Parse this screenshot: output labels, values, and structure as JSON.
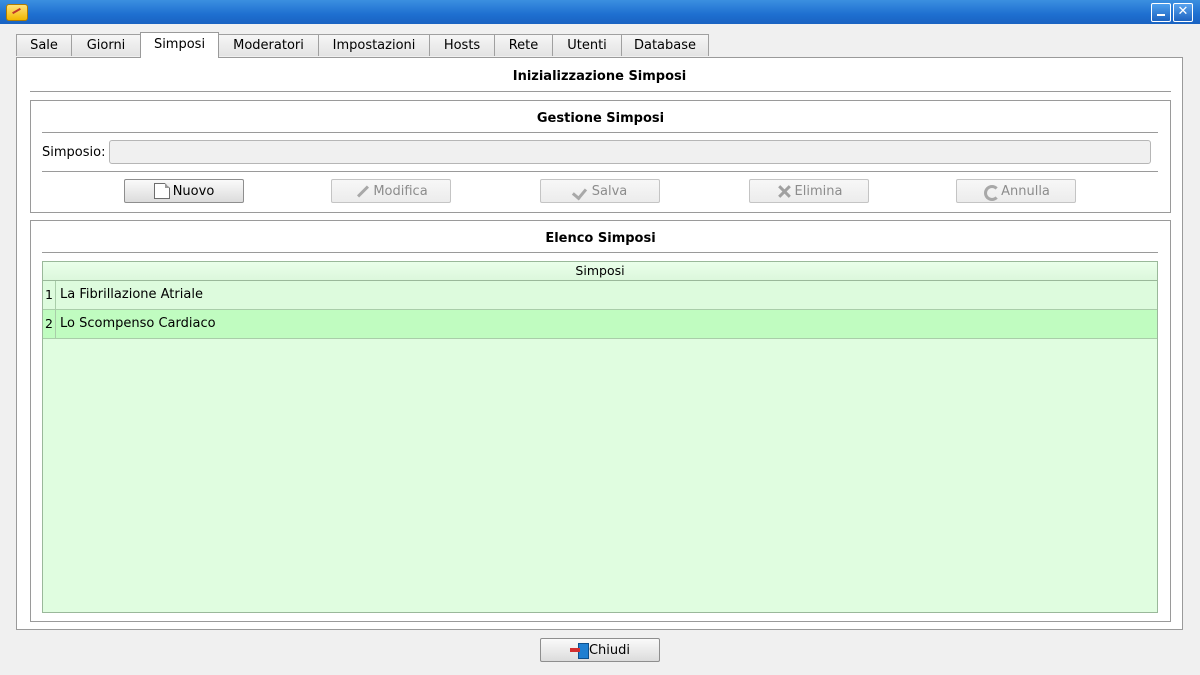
{
  "window": {
    "icon": "app-icon",
    "controls": {
      "minimize_icon": "minimize-icon",
      "close_icon": "close-icon",
      "close_glyph": "✕"
    }
  },
  "tabs": [
    {
      "label": "Sale",
      "active": false
    },
    {
      "label": "Giorni",
      "active": false
    },
    {
      "label": "Simposi",
      "active": true
    },
    {
      "label": "Moderatori",
      "active": false
    },
    {
      "label": "Impostazioni",
      "active": false
    },
    {
      "label": "Hosts",
      "active": false
    },
    {
      "label": "Rete",
      "active": false
    },
    {
      "label": "Utenti",
      "active": false
    },
    {
      "label": "Database",
      "active": false
    }
  ],
  "main": {
    "title": "Inizializzazione Simposi",
    "gestione": {
      "title": "Gestione Simposi",
      "field_label": "Simposio:",
      "field_value": "",
      "buttons": {
        "nuovo": "Nuovo",
        "modifica": "Modifica",
        "salva": "Salva",
        "elimina": "Elimina",
        "annulla": "Annulla"
      },
      "button_states": {
        "nuovo": "enabled",
        "modifica": "disabled",
        "salva": "disabled",
        "elimina": "disabled",
        "annulla": "disabled"
      }
    },
    "elenco": {
      "title": "Elenco Simposi",
      "column": "Simposi",
      "rows": [
        {
          "num": "1",
          "name": "La Fibrillazione Atriale",
          "selected": false
        },
        {
          "num": "2",
          "name": "Lo Scompenso Cardiaco",
          "selected": true
        }
      ]
    }
  },
  "footer": {
    "close_label": "Chiudi"
  },
  "colors": {
    "grid_bg": "#e0fde0",
    "selected_row": "#c0fcc0",
    "titlebar": "#1e6fd0"
  }
}
